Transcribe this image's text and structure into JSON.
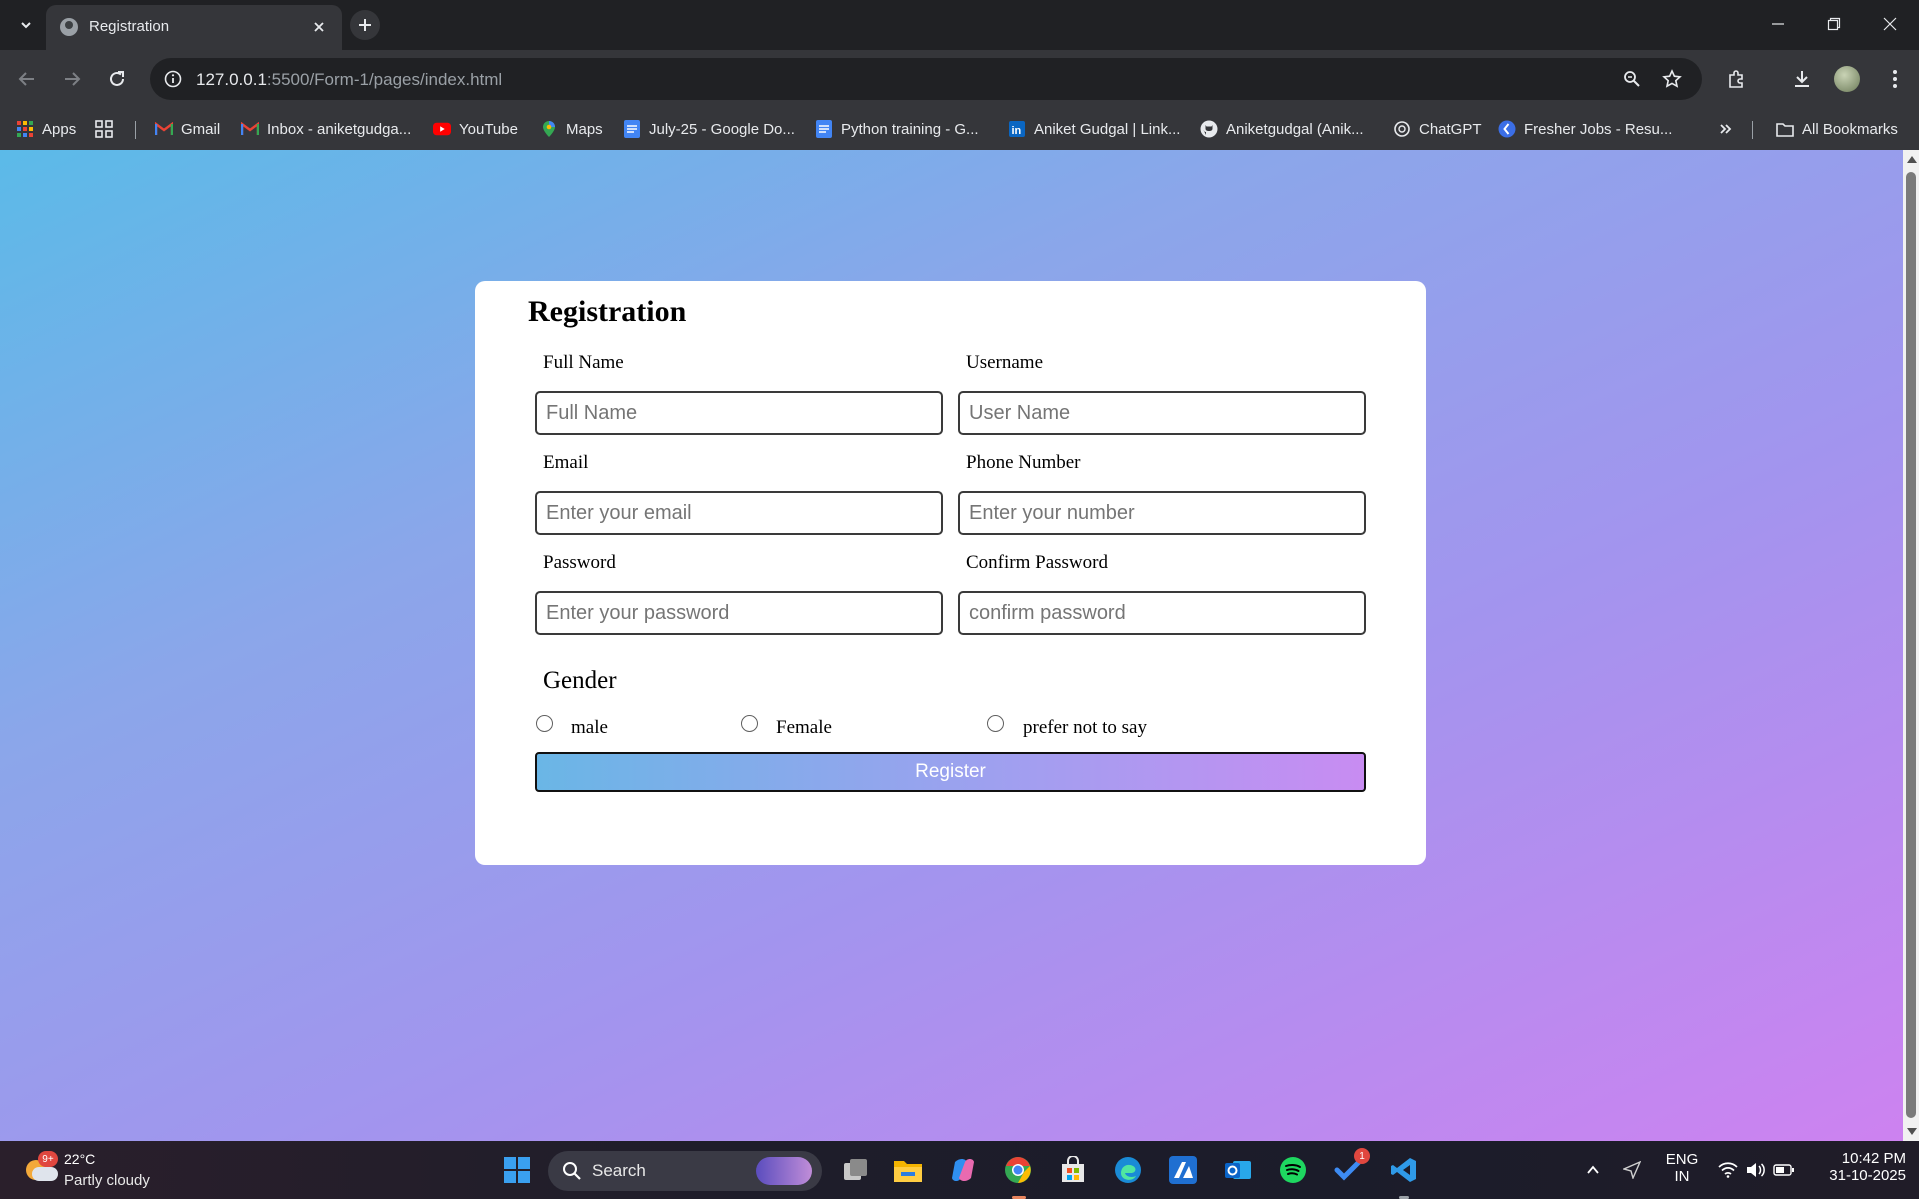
{
  "browser": {
    "tab_title": "Registration",
    "url_host": "127.0.0.1",
    "url_rest": ":5500/Form-1/pages/index.html",
    "bookmarks": [
      {
        "label": "Apps",
        "icon": "apps-grid-icon"
      },
      {
        "label": "",
        "icon": "grid-icon"
      },
      {
        "label": "Gmail",
        "icon": "gmail-icon"
      },
      {
        "label": "Inbox - aniketgudga...",
        "icon": "gmail-icon"
      },
      {
        "label": "YouTube",
        "icon": "youtube-icon"
      },
      {
        "label": "Maps",
        "icon": "maps-icon"
      },
      {
        "label": "July-25 - Google Do...",
        "icon": "docs-icon"
      },
      {
        "label": "Python training - G...",
        "icon": "docs-icon"
      },
      {
        "label": "Aniket Gudgal | Link...",
        "icon": "linkedin-icon"
      },
      {
        "label": "Aniketgudgal (Anik...",
        "icon": "github-icon"
      },
      {
        "label": "ChatGPT",
        "icon": "chatgpt-icon"
      },
      {
        "label": "Fresher Jobs - Resu...",
        "icon": "fresher-jobs-icon"
      }
    ],
    "all_bookmarks": "All Bookmarks"
  },
  "form": {
    "title": "Registration",
    "full_name_label": "Full Name",
    "full_name_placeholder": "Full Name",
    "username_label": "Username",
    "username_placeholder": "User Name",
    "email_label": "Email",
    "email_placeholder": "Enter your email",
    "phone_label": "Phone Number",
    "phone_placeholder": "Enter your number",
    "password_label": "Password",
    "password_placeholder": "Enter your password",
    "confirm_label": "Confirm Password",
    "confirm_placeholder": "confirm password",
    "gender_title": "Gender",
    "gender_options": [
      "male",
      "Female",
      "prefer not to say"
    ],
    "register_label": "Register"
  },
  "taskbar": {
    "temperature": "22°C",
    "weather": "Partly cloudy",
    "weather_badge": "9+",
    "search_label": "Search",
    "todo_badge": "1",
    "lang_top": "ENG",
    "lang_bottom": "IN",
    "time": "10:42 PM",
    "date": "31-10-2025"
  }
}
